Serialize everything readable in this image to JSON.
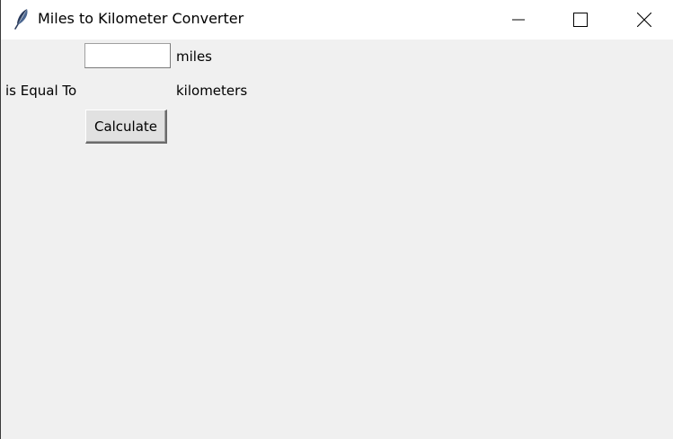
{
  "window": {
    "title": "Miles to Kilometer Converter",
    "icons": {
      "app": "feather-icon",
      "minimize": "minimize-icon",
      "maximize": "maximize-icon",
      "close": "close-icon"
    }
  },
  "form": {
    "miles_value": "",
    "miles_label": "miles",
    "equal_label": "is Equal To",
    "result_value": "",
    "km_label": "kilometers",
    "calculate_label": "Calculate"
  },
  "colors": {
    "background": "#f0f0f0",
    "titlebar": "#ffffff"
  }
}
